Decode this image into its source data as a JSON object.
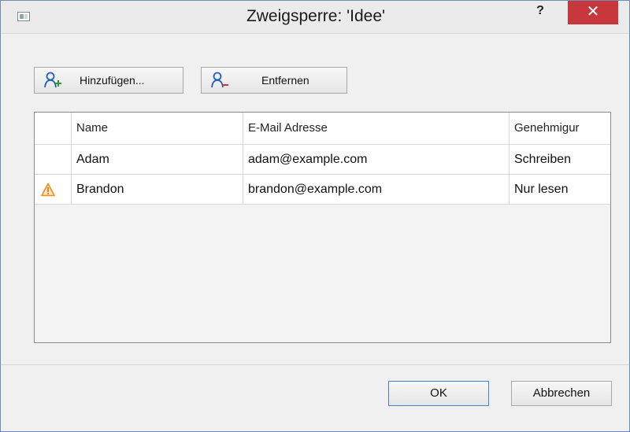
{
  "window": {
    "title": "Zweigsperre: 'Idee'",
    "help_label": "?",
    "close_label": "✕"
  },
  "toolbar": {
    "add_label": "Hinzufügen...",
    "remove_label": "Entfernen"
  },
  "table": {
    "columns": [
      "",
      "Name",
      "E-Mail Adresse",
      "Genehmigur"
    ],
    "rows": [
      {
        "warning": false,
        "name": "Adam",
        "email": "adam@example.com",
        "permission": "Schreiben"
      },
      {
        "warning": true,
        "name": "Brandon",
        "email": "brandon@example.com",
        "permission": "Nur lesen"
      }
    ]
  },
  "buttons": {
    "ok_label": "OK",
    "cancel_label": "Abbrechen"
  },
  "colors": {
    "close_red": "#c8373c",
    "icon_blue": "#1f5fbf",
    "warning_orange": "#f08c1a"
  }
}
